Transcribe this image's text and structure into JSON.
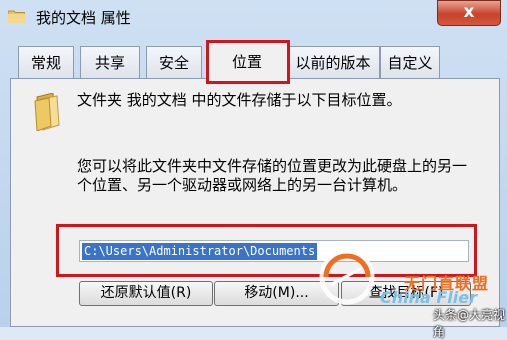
{
  "window": {
    "title": "我的文档 属性",
    "close_label": "x"
  },
  "tabs": [
    "常规",
    "共享",
    "安全",
    "位置",
    "以前的版本",
    "自定义"
  ],
  "active_tab": "位置",
  "content": {
    "description": "文件夹 我的文档 中的文件存储于以下目标位置。",
    "info": "您可以将此文件夹中文件存储的位置更改为此硬盘上的另一个位置、另一个驱动器或网络上的另一台计算机。",
    "path": "C:\\Users\\Administrator\\Documents"
  },
  "buttons": {
    "restore_default": "还原默认值(R)",
    "move": "移动(M)...",
    "find_target": "查找目标(F)"
  },
  "watermark": {
    "brand": "无门直联盟",
    "brand_en": "China Flier",
    "author": "头条@大亮视角"
  },
  "colors": {
    "highlight_box": "#d0161a",
    "selection": "#3a73c9"
  },
  "icons": {
    "title": "folder-icon",
    "content": "folder-icon"
  }
}
